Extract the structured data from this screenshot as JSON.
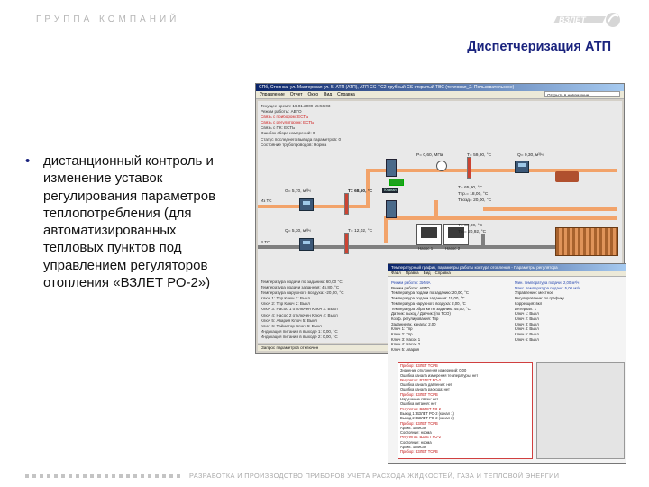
{
  "header": {
    "company": "ГРУППА КОМПАНИЙ",
    "logo_text": "ВЗЛЕТ",
    "title": "Диспетчеризация АТП"
  },
  "bullet": {
    "marker": "•",
    "text": "дистанционный контроль и изменение уставок регулирования параметров теплопотребления (для автоматизированных тепловых пунктов под управлением регуляторов отопления «ВЗЛЕТ РО-2»)"
  },
  "footer": {
    "text": "РАЗРАБОТКА И ПРОИЗВОДСТВО ПРИБОРОВ УЧЕТА РАСХОДА ЖИДКОСТЕЙ, ГАЗА И ТЕПЛОВОЙ ЭНЕРГИИ"
  },
  "window1": {
    "title": "СПб, Стоянка, ул. Мастерская ул. 5, АТП (АТП), АТП СС-ТС2-трубный CS открытый ТВС (тепловая_2. Пользовательское)",
    "menu": [
      "Управление",
      "Отчет",
      "Окно",
      "Вид",
      "Справка"
    ],
    "toolbar_dropdown": "Открыть в новом окне",
    "status_lines": [
      {
        "text": "Текущее время: 16.01.2009 15:56:03",
        "tone": "normal"
      },
      {
        "text": "Режим работы: АВТО",
        "tone": "normal"
      },
      {
        "text": "Связь с прибором: ЕСТЬ",
        "tone": "red"
      },
      {
        "text": "Связь с регулятором: ЕСТЬ",
        "tone": "red"
      },
      {
        "text": "Связь с ПК: ЕСТЬ",
        "tone": "normal"
      },
      {
        "text": "Ошибок сбора измерений: 0",
        "tone": "normal"
      },
      {
        "text": "Статус последнего вывода параметров: 0",
        "tone": "normal"
      },
      {
        "text": "Состояние трубопроводов: Норма",
        "tone": "normal"
      }
    ],
    "readings": {
      "p_top": "P= 0,60, МПа",
      "t_top": "T= 59,90, °C",
      "q_top": "Q= 0,30, м³/ч",
      "g_left": "G= 5,70, м³/ч",
      "t_mid": "T= 68,50, °C",
      "valve": "Клапан",
      "t_right_1": "T= 65,90, °C",
      "t_right_2": "Tтр.= 18,00, °C",
      "t_right_3": "Tвозд= 20,00, °C",
      "t_return_1": "T= 37,90, °C",
      "t_return_2": "Tо.= 20,92, °C",
      "q_bottom": "Q= 5,30, м³/ч",
      "t_bottom": "T= 12,02, °C",
      "from_ts": "Из ТС",
      "to_ts": "В ТС",
      "pump1": "Насос 1",
      "pump2": "Насос 2"
    },
    "bottom_lines": [
      "Температура подачи по заданию: 60,00 °C",
      "Температура подачи заданная: 45,80, °C",
      "Температура наружного воздуха: -20,00, °C",
      "Ключ 1: Тпр                Ключ 1: Выкл",
      "Ключ 2: Тпр                Ключ 2: Выкл",
      "Ключ 3: Насос 1 отключен    Ключ 3: Выкл",
      "Ключ 4: Насос 2 отключен    Ключ 4: Выкл",
      "Ключ 5: Авария              Ключ 5: Выкл",
      "Ключ 6: Тайматор            Ключ 6: Выкл",
      "Индикация питания в выходе 1: 0,00, °C",
      "Индикация питания в выходе 2: 0,00, °C"
    ],
    "status_bar": "Запрос параметров отключен"
  },
  "window2": {
    "title": "Температурный график, параметры работы контура отопления - Параметры регулятора",
    "menu": [
      "Файл",
      "Правка",
      "Вид",
      "Справка"
    ],
    "left_lines": [
      {
        "text": "Режим работы: ЗИМА",
        "tone": "blue"
      },
      {
        "text": "Режим работы: АВТО",
        "tone": "normal"
      },
      {
        "text": "Температура подачи по заданию: 20,00, °C",
        "tone": "normal"
      },
      {
        "text": "Температура подачи заданная: 15,00, °C",
        "tone": "normal"
      },
      {
        "text": "Температура наружного воздуха: 2,00, °C",
        "tone": "normal"
      },
      {
        "text": "Температура обратки по заданию: 45,00, °C",
        "tone": "normal"
      },
      {
        "text": "Датчик: выход / Датчик: (по ТСО)",
        "tone": "normal"
      },
      {
        "text": "Коэф. регулирования: Тпр",
        "tone": "normal"
      },
      {
        "text": "Задание вк. канала: 2,00",
        "tone": "normal"
      },
      {
        "text": "Ключ 1: Тпр",
        "tone": "normal"
      },
      {
        "text": "Ключ 2: Тпр",
        "tone": "normal"
      },
      {
        "text": "Ключ 3: Насос 1",
        "tone": "normal"
      },
      {
        "text": "Ключ 4: Насос 2",
        "tone": "normal"
      },
      {
        "text": "Ключ 5: Авария",
        "tone": "normal"
      }
    ],
    "right_lines": [
      {
        "text": "Мин. температура подачи: 2,00 м³/ч",
        "tone": "blue"
      },
      {
        "text": "Макс. температура подачи: 5,00 м³/ч",
        "tone": "blue"
      },
      {
        "text": "Управление: местное",
        "tone": "normal"
      },
      {
        "text": "Регулирование: по графику",
        "tone": "normal"
      },
      {
        "text": "Коррекция: вкл",
        "tone": "normal"
      },
      {
        "text": "Интервал: 1",
        "tone": "normal"
      },
      {
        "text": "Ключ 1: Выкл",
        "tone": "normal"
      },
      {
        "text": "Ключ 2: Выкл",
        "tone": "normal"
      },
      {
        "text": "Ключ 3: Выкл",
        "tone": "normal"
      },
      {
        "text": "Ключ 4: Выкл",
        "tone": "normal"
      },
      {
        "text": "Ключ 5: Выкл",
        "tone": "normal"
      },
      {
        "text": "Ключ 6: Выкл",
        "tone": "normal"
      }
    ],
    "error_lines": [
      {
        "text": "Прибор: ВЗЛЕТ ТСРВ",
        "tone": "red"
      },
      {
        "text": "Значение отклонения измерений: 0,00",
        "tone": "blk"
      },
      {
        "text": "Ошибка канала измерения температуры: нет",
        "tone": "blk"
      },
      {
        "text": "Регулятор: ВЗЛЕТ РО-2",
        "tone": "red"
      },
      {
        "text": "Ошибка канала давления: нет",
        "tone": "blk"
      },
      {
        "text": "Ошибка канала расхода: нет",
        "tone": "blk"
      },
      {
        "text": "Прибор: ВЗЛЕТ ТСРВ",
        "tone": "red"
      },
      {
        "text": "Нарушение связи: нет",
        "tone": "blk"
      },
      {
        "text": "Ошибка питания: нет",
        "tone": "blk"
      },
      {
        "text": "Регулятор: ВЗЛЕТ РО-2",
        "tone": "red"
      },
      {
        "text": "Выход 1: ВЗЛЕТ РО-2 (канал 1)",
        "tone": "blk"
      },
      {
        "text": "Выход 2: ВЗЛЕТ РО-2 (канал 2)",
        "tone": "blk"
      },
      {
        "text": "Прибор: ВЗЛЕТ ТСРВ",
        "tone": "red"
      },
      {
        "text": "Архив: записан",
        "tone": "blk"
      },
      {
        "text": "Состояние: норма",
        "tone": "blk"
      },
      {
        "text": "Регулятор: ВЗЛЕТ РО-2",
        "tone": "red"
      },
      {
        "text": "Состояние: норма",
        "tone": "blk"
      },
      {
        "text": "Архив: записан",
        "tone": "blk"
      },
      {
        "text": "Прибор: ВЗЛЕТ ТСРВ",
        "tone": "red"
      }
    ]
  },
  "colors": {
    "title": "#1a237e",
    "pipe_hot": "#f2a36a",
    "pipe_grey": "#7f7f7f",
    "alarm": "#d02020"
  }
}
